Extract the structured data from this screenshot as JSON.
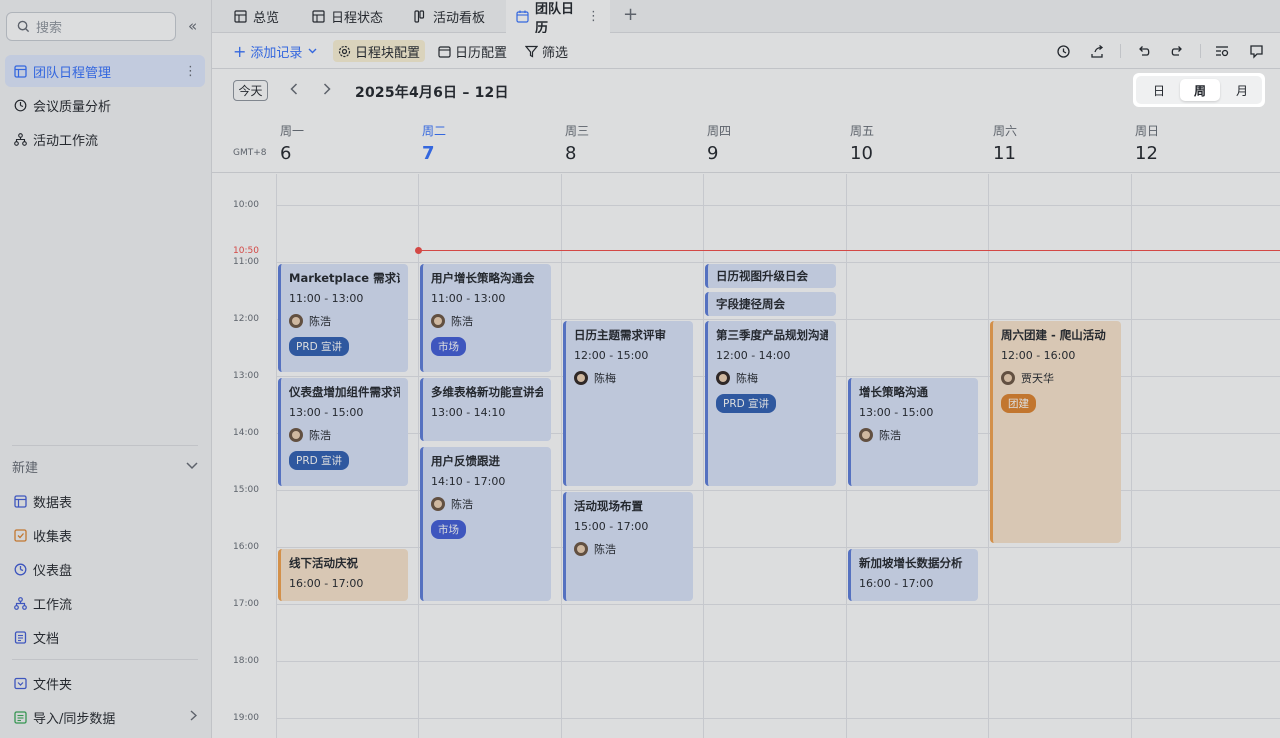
{
  "sidebar": {
    "search_placeholder": "搜索",
    "collapse_glyph": "«",
    "items": [
      {
        "label": "团队日程管理",
        "icon": "table-icon",
        "active": true
      },
      {
        "label": "会议质量分析",
        "icon": "dashboard-icon"
      },
      {
        "label": "活动工作流",
        "icon": "workflow-icon"
      }
    ],
    "new_label": "新建",
    "new_items": [
      {
        "label": "数据表",
        "icon": "table-icon"
      },
      {
        "label": "收集表",
        "icon": "form-icon"
      },
      {
        "label": "仪表盘",
        "icon": "dashboard-icon"
      },
      {
        "label": "工作流",
        "icon": "workflow-icon"
      },
      {
        "label": "文档",
        "icon": "doc-icon"
      }
    ],
    "folder_label": "文件夹",
    "import_label": "导入/同步数据"
  },
  "tabs": [
    {
      "label": "总览",
      "icon": "grid-icon"
    },
    {
      "label": "日程状态",
      "icon": "grid-icon"
    },
    {
      "label": "活动看板",
      "icon": "kanban-icon"
    },
    {
      "label": "团队日历",
      "icon": "calendar-icon",
      "active": true
    }
  ],
  "toolbar": {
    "add_record": "添加记录",
    "block_config": "日程块配置",
    "calendar_config": "日历配置",
    "filter": "筛选"
  },
  "nav": {
    "today": "今天",
    "range": "2025年4月6日 – 12日",
    "views": [
      "日",
      "周",
      "月"
    ],
    "active_view": "周"
  },
  "header": {
    "timezone": "GMT+8",
    "days": [
      {
        "weekday": "周一",
        "date": "6"
      },
      {
        "weekday": "周二",
        "date": "7",
        "today": true
      },
      {
        "weekday": "周三",
        "date": "8"
      },
      {
        "weekday": "周四",
        "date": "9"
      },
      {
        "weekday": "周五",
        "date": "10"
      },
      {
        "weekday": "周六",
        "date": "11"
      },
      {
        "weekday": "周日",
        "date": "12"
      }
    ]
  },
  "grid": {
    "hours": [
      "10:00",
      "11:00",
      "12:00",
      "13:00",
      "14:00",
      "15:00",
      "16:00",
      "17:00",
      "18:00",
      "19:00"
    ],
    "now_label": "10:50"
  },
  "events": [
    {
      "title": "Marketplace 需求评审",
      "time": "11:00 - 13:00",
      "person": "陈浩",
      "tag": "PRD 宣讲"
    },
    {
      "title": "仪表盘增加组件需求评审",
      "time": "13:00 - 15:00",
      "person": "陈浩",
      "tag": "PRD 宣讲"
    },
    {
      "title": "线下活动庆祝",
      "time": "16:00 - 17:00"
    },
    {
      "title": "用户增长策略沟通会",
      "time": "11:00 - 13:00",
      "person": "陈浩",
      "tag": "市场"
    },
    {
      "title": "多维表格新功能宣讲会",
      "time": "13:00 - 14:10"
    },
    {
      "title": "用户反馈跟进",
      "time": "14:10 - 17:00",
      "person": "陈浩",
      "tag": "市场"
    },
    {
      "title": "日历主题需求评审",
      "time": "12:00 - 15:00",
      "person": "陈梅"
    },
    {
      "title": "活动现场布置",
      "time": "15:00 - 17:00",
      "person": "陈浩"
    },
    {
      "title": "日历视图升级日会"
    },
    {
      "title": "字段捷径周会"
    },
    {
      "title": "第三季度产品规划沟通",
      "time": "12:00 - 14:00",
      "person": "陈梅",
      "tag": "PRD 宣讲"
    },
    {
      "title": "增长策略沟通",
      "time": "13:00 - 15:00",
      "person": "陈浩"
    },
    {
      "title": "新加坡增长数据分析",
      "time": "16:00 - 17:00"
    },
    {
      "title": "周六团建 - 爬山活动",
      "time": "12:00 - 16:00",
      "person": "贾天华",
      "tag": "团建"
    }
  ]
}
